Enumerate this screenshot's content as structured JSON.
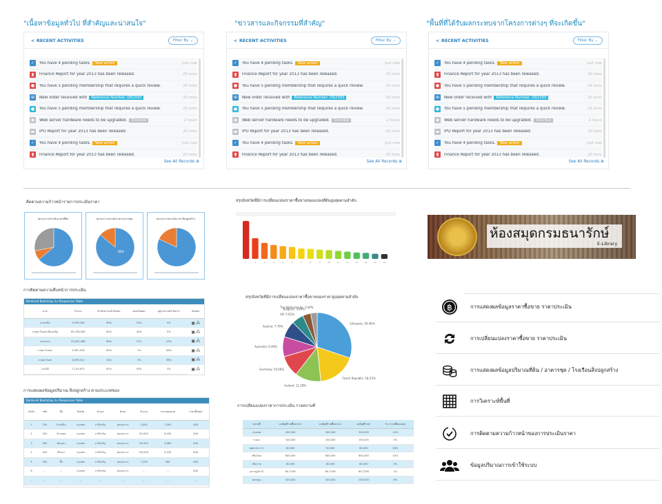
{
  "sections": [
    {
      "title": "\"เนื้อหาข้อมูลทั่วไป ที่สำคัญและน่าสนใจ\""
    },
    {
      "title": "\"ข่าวสารและกิจกรรมที่สำคัญ\""
    },
    {
      "title": "\"พื้นที่ที่ได้รับผลกระทบจากโครงการต่างๆ ที่จะเกิดขึ้น\""
    }
  ],
  "recent_activities": {
    "title": "RECENT ACTIVITIES",
    "filter_label": "Filter By",
    "see_all": "See All Records",
    "items": [
      {
        "text": "You have 4 pending tasks.",
        "tag": "Take action",
        "tag_color": "#f0ad1a",
        "time": "Just now",
        "icon_color": "#3c8dce",
        "icon": "check-icon"
      },
      {
        "text": "Finance Report for year 2013 has been released.",
        "tag": "",
        "tag_color": "",
        "time": "20 mins",
        "icon_color": "#e14a4a",
        "icon": "bar-chart-icon"
      },
      {
        "text": "You have 5 pending membership that requires a quick review.",
        "tag": "",
        "tag_color": "",
        "time": "24 mins",
        "icon_color": "#e14a4a",
        "icon": "user-icon"
      },
      {
        "text": "New order received with",
        "tag": "Reference Number: DR2393",
        "tag_color": "#33b9dd",
        "time": "30 mins",
        "icon_color": "#3c8dce",
        "icon": "cart-icon"
      },
      {
        "text": "You have 5 pending membership that requires a quick review.",
        "tag": "",
        "tag_color": "",
        "time": "24 mins",
        "icon_color": "#33b9dd",
        "icon": "user-icon"
      },
      {
        "text": "Web server hardware needs to be upgraded.",
        "tag": "Overdue",
        "tag_color": "#b9bec4",
        "time": "2 hours",
        "icon_color": "#c0c4c8",
        "icon": "bell-icon"
      },
      {
        "text": "IPO Report for year 2013 has been released.",
        "tag": "",
        "tag_color": "",
        "time": "20 mins",
        "icon_color": "#c0c4c8",
        "icon": "comment-icon"
      },
      {
        "text": "You have 4 pending tasks.",
        "tag": "Take action",
        "tag_color": "#f0ad1a",
        "time": "Just now",
        "icon_color": "#3c8dce",
        "icon": "check-icon"
      },
      {
        "text": "Finance Report for year 2013 has been released.",
        "tag": "",
        "tag_color": "",
        "time": "20 mins",
        "icon_color": "#e14a4a",
        "icon": "bar-chart-icon"
      }
    ]
  },
  "left_column": {
    "progress_title": "ติดตามความก้าวหน้ารายการประเมินราคา",
    "pie_cards": [
      {
        "title": "สถานะการประเมินราคาที่ดิน",
        "slices": [
          {
            "value": 64,
            "color": "#4b97d6"
          },
          {
            "value": 8,
            "color": "#e97d33"
          },
          {
            "value": 28,
            "color": "#9b9b9b"
          }
        ]
      },
      {
        "title": "สถานะการประเมินราคาอาคารชุด",
        "slices": [
          {
            "value": 86,
            "color": "#4b97d6"
          },
          {
            "value": 14,
            "color": "#e97d33"
          }
        ],
        "label": "86%"
      },
      {
        "title": "สถานะการประเมินราคาสิ่งปลูกสร้าง",
        "slices": [
          {
            "value": 82,
            "color": "#4b97d6"
          },
          {
            "value": 18,
            "color": "#e97d33"
          }
        ]
      }
    ],
    "status_title": "การติดตามความคืบหน้าการประเมิน",
    "status_table": {
      "header": "Bordered Bootstrap 3.x Responsive Table",
      "columns": [
        "ภาค",
        "จำนวน",
        "ดำเนินการแล้วร้อยละ",
        "ลดลงร้อยละ",
        "อยู่ระหว่างดำเนินการ",
        "Action"
      ],
      "rows": [
        [
          "ภาคเหนือ",
          "9,999,256",
          "89%",
          "10%",
          "9%"
        ],
        [
          "ภาคตะวันออกเฉียงเหนือ",
          "85,708,289",
          "65%",
          "43%",
          "5%"
        ],
        [
          "ภาคกลาง",
          "25,847,986",
          "89%",
          "27%",
          "19%"
        ],
        [
          "ภาคตะวันออก",
          "5,587,256",
          "69%",
          "1%",
          "38%"
        ],
        [
          "ภาคตะวันตก",
          "3,859,014",
          "32%",
          "3%",
          "98%"
        ],
        [
          "ภาคใต้",
          "7,123,870",
          "87%",
          "93%",
          "3%"
        ]
      ]
    },
    "build_title": "การแสดงผลข้อมูลปริมาณ สิ่งปลูกสร้าง ตามประเภทของ",
    "build_table": {
      "header": "Bordered Bootstrap 3.x Responsive Table",
      "columns": [
        "ลำดับ",
        "รหัส",
        "ชื่อ",
        "จังหวัด",
        "อำเภอ",
        "ตำบล",
        "จำนวน",
        "ราคาต่อหน่วย",
        "ราคาทั้งหมด"
      ],
      "rows": [
        [
          "1",
          "100",
          "บ้านเดี่ยว",
          "กรุงเทพ",
          "ภาษีเจริญ",
          "คลองขวาง",
          "5,000",
          "7,000",
          "XXX"
        ],
        [
          "2",
          "200",
          "บ้านแฝด",
          "กรุงเทพ",
          "ภาษีเจริญ",
          "คลองขวาง",
          "62,000",
          "6,000",
          "XXX"
        ],
        [
          "3",
          "300",
          "ห้องแถว",
          "กรุงเทพ",
          "ภาษีเจริญ",
          "คลองขวาง",
          "85,525",
          "5,880",
          "XXX"
        ],
        [
          "4",
          "400",
          "ตึกแถว",
          "กรุงเทพ",
          "ภาษีเจริญ",
          "คลองขวาง",
          "89,258",
          "5,330",
          "XXX"
        ],
        [
          "5",
          "500",
          "ปั๊ม",
          "กรุงเทพ",
          "ภาษีเจริญ",
          "คลองขวาง",
          "1,258",
          "580",
          "XXX"
        ],
        [
          "6",
          "...",
          "...",
          "กรุงเทพ",
          "ภาษีเจริญ",
          "คลองขวาง",
          "...",
          "...",
          "XXX"
        ],
        [
          "...",
          "...",
          "...",
          "...",
          "...",
          "...",
          "...",
          "...",
          "..."
        ]
      ]
    }
  },
  "middle_column": {
    "bar_title": "สรุปจังหวัดที่มีการเปลี่ยนแปลงราคาซื้อขายของแปลงที่ดินสูงสุดตามลำดับ",
    "pie_title": "สรุปจังหวัดที่มีการเปลี่ยนแปลงราคาซื้อขายของราคาสูงสุดตามลำดับ",
    "change_title": "การเปลี่ยนแปลงราคาการประเมิน รายสถานที่",
    "change_table": {
      "columns": [
        "สถานที่",
        "ลงบัญชีรายซื้อขาย 2",
        "ลงบัญชีรายซื้อขาย 1",
        "ลงบัญชีราคา",
        "% การเปลี่ยนแปลง"
      ],
      "rows": [
        [
          "กรุงเทพ",
          "200,000",
          "300,000",
          "300,000",
          "10%"
        ],
        [
          "ระยอง",
          "100,000",
          "150,000",
          "100,000",
          "5%"
        ],
        [
          "สมุทรปราการ",
          "80,000",
          "50,000",
          "80,000",
          "28%"
        ],
        [
          "เชียงใหม่",
          "800,000",
          "800,000",
          "800,000",
          "10%"
        ],
        [
          "เชียงราย",
          "80,000",
          "80,000",
          "80,000",
          "5%"
        ],
        [
          "สุราษฎร์ธานี",
          "89,7256",
          "89,7256",
          "89,7256",
          "1%"
        ],
        [
          "นครปฐม",
          "100,000",
          "100,000",
          "100,000",
          "6%"
        ]
      ]
    }
  },
  "chart_data": [
    {
      "type": "bar",
      "categories": [
        "1",
        "2",
        "3",
        "4",
        "5",
        "6",
        "7",
        "8",
        "9",
        "10",
        "11",
        "12",
        "13",
        "14",
        "15",
        "16"
      ],
      "values": [
        95,
        52,
        40,
        35,
        32,
        30,
        26,
        25,
        23,
        22,
        20,
        18,
        16,
        15,
        13,
        12
      ],
      "colors": [
        "#d62a1e",
        "#e8401c",
        "#f2681c",
        "#f48b1a",
        "#f7a917",
        "#f8c414",
        "#f6d311",
        "#e8df10",
        "#cfe01a",
        "#b2dd27",
        "#8fd635",
        "#6dcd47",
        "#4ec05c",
        "#3fae73",
        "#3a8a8d",
        "#333"
      ],
      "ylim": [
        0,
        100
      ]
    },
    {
      "type": "pie",
      "labels": [
        "Lithuania",
        "Czech Republic",
        "Ireland",
        "Germany",
        "Australia",
        "Austria",
        "UK",
        "Belgium",
        "The Netherlands"
      ],
      "values": [
        30.46,
        18.33,
        12.28,
        10.06,
        9.49,
        7.79,
        5.61,
        3.84,
        3.09
      ],
      "label_text": [
        "Lithuania: 30.46%",
        "Czech Republic: 18.33%",
        "Ireland: 12.28%",
        "Germany: 10.06%",
        "Australia: 9.49%",
        "Austria: 7.79%",
        "UK: 5.61%",
        "Belgium: 3.84%",
        "The Netherlands: 3.09%"
      ],
      "colors": [
        "#4a9fd8",
        "#f5c91b",
        "#8dc353",
        "#e0474c",
        "#c84da0",
        "#2f4f8a",
        "#2d8a8a",
        "#8a5a3a",
        "#9b9b9b"
      ]
    }
  ],
  "banner": {
    "title": "ห้องสมุดกรมธนารักษ์",
    "subtitle": "E-Library"
  },
  "features": [
    {
      "icon": "baht-coin-icon",
      "label": "การแสดงผลข้อมูลราคาซื้อขาย ราคาประเมิน"
    },
    {
      "icon": "sync-arrows-icon",
      "label": "การเปลี่ยนแปลงราคาซื้อขาย ราคาประเมิน"
    },
    {
      "icon": "coins-stack-icon",
      "label": "การแสดงผลข้อมูลปริมาณที่ดิน / อาคารชุด / โรงเรือนสิ่งปลูกสร้าง"
    },
    {
      "icon": "grid-icon",
      "label": "การวิเคราะห์พื้นที่"
    },
    {
      "icon": "clock-check-icon",
      "label": "การติดตามความก้าวหน้าของการประเมินราคา"
    },
    {
      "icon": "users-icon",
      "label": "ข้อมูลปริมาณการเข้าใช้ระบบ"
    }
  ]
}
